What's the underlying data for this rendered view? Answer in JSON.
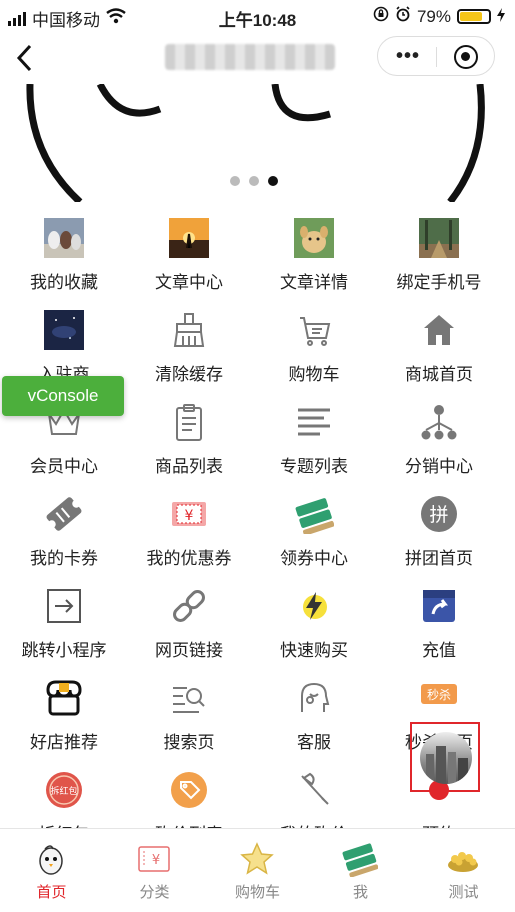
{
  "status": {
    "carrier": "中国移动",
    "time": "上午10:48",
    "battery": "79%",
    "battery_level": 0.79
  },
  "grid": [
    {
      "label": "我的收藏",
      "icon": "dogs-photo-icon"
    },
    {
      "label": "文章中心",
      "icon": "sunset-photo-icon"
    },
    {
      "label": "文章详情",
      "icon": "puppy-photo-icon"
    },
    {
      "label": "绑定手机号",
      "icon": "forest-photo-icon"
    },
    {
      "label": "入驻商",
      "icon": "space-photo-icon"
    },
    {
      "label": "清除缓存",
      "icon": "broom-icon"
    },
    {
      "label": "购物车",
      "icon": "cart-icon"
    },
    {
      "label": "商城首页",
      "icon": "home-icon"
    },
    {
      "label": "会员中心",
      "icon": "crown-icon"
    },
    {
      "label": "商品列表",
      "icon": "clipboard-icon"
    },
    {
      "label": "专题列表",
      "icon": "list-lines-icon"
    },
    {
      "label": "分销中心",
      "icon": "network-icon"
    },
    {
      "label": "我的卡券",
      "icon": "ticket-icon"
    },
    {
      "label": "我的优惠券",
      "icon": "coupon-yen-icon"
    },
    {
      "label": "领券中心",
      "icon": "coupon-stack-icon"
    },
    {
      "label": "拼团首页",
      "icon": "group-buy-icon"
    },
    {
      "label": "跳转小程序",
      "icon": "jump-icon"
    },
    {
      "label": "网页链接",
      "icon": "link-icon"
    },
    {
      "label": "快速购买",
      "icon": "lightning-icon"
    },
    {
      "label": "充值",
      "icon": "recharge-icon"
    },
    {
      "label": "好店推荐",
      "icon": "shop-icon"
    },
    {
      "label": "搜索页",
      "icon": "search-list-icon"
    },
    {
      "label": "客服",
      "icon": "customer-service-icon"
    },
    {
      "label": "秒杀首页",
      "icon": "flash-sale-icon",
      "badge": "秒杀"
    },
    {
      "label": "拆红包",
      "icon": "red-packet-icon",
      "badge": "拆红包"
    },
    {
      "label": "砍价列表",
      "icon": "bargain-tag-icon"
    },
    {
      "label": "我的砍价",
      "icon": "axe-icon"
    },
    {
      "label": "预约",
      "icon": "reserve-icon"
    }
  ],
  "vconsole": {
    "label": "vConsole"
  },
  "tabs": [
    {
      "label": "首页",
      "icon": "chick-icon",
      "active": true
    },
    {
      "label": "分类",
      "icon": "coupon-icon",
      "active": false
    },
    {
      "label": "购物车",
      "icon": "star-icon",
      "active": false
    },
    {
      "label": "我",
      "icon": "ticket-stack-icon",
      "active": false
    },
    {
      "label": "测试",
      "icon": "food-bowl-icon",
      "active": false
    }
  ],
  "colors": {
    "accent": "#e0262b",
    "vconsole": "#4caf3c"
  }
}
